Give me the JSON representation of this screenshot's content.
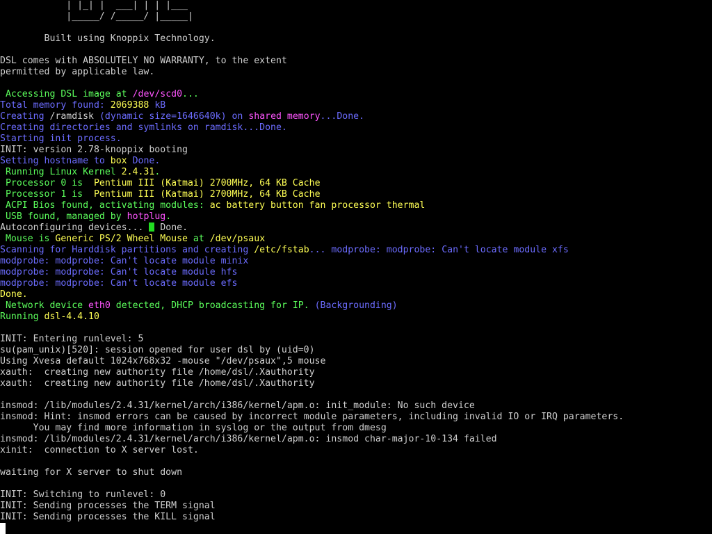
{
  "terminal": {
    "banner": {
      "ascii_line_1": "            | |_| |  ___| | | |___",
      "ascii_line_2": "            |_____/ /_____/ |_____|",
      "built_with": "        Built using Knoppix Technology.",
      "warranty_1": "DSL comes with ABSOLUTELY NO WARRANTY, to the extent",
      "warranty_2": "permitted by applicable law."
    },
    "boot": {
      "access_prefix": " Accessing DSL image at ",
      "access_dev": "/dev/scd0",
      "access_suffix": "...",
      "mem_label": "Total memory found: ",
      "mem_value": "2069388",
      "mem_unit": " kB",
      "ramdisk_prefix": "Creating ",
      "ramdisk_name": "/ramdisk",
      "ramdisk_mid": " (dynamic size=1646640k) on ",
      "ramdisk_shared": "shared memory",
      "ramdisk_done": "...Done.",
      "dirs": "Creating directories and symlinks on ramdisk...Done.",
      "init_proc": "Starting init process.",
      "init_version": "INIT: version 2.78-knoppix booting",
      "hostname_prefix": "Setting hostname to ",
      "hostname_value": "box",
      "hostname_done": " Done.",
      "kernel_label": " Running Linux Kernel ",
      "kernel_version": "2.4.31",
      "kernel_dot": ".",
      "cpu0_label": " Processor 0 is  ",
      "cpu0_value": "Pentium III (Katmai) 2700MHz, 64 KB Cache",
      "cpu1_label": " Processor 1 is  ",
      "cpu1_value": "Pentium III (Katmai) 2700MHz, 64 KB Cache",
      "acpi_label": " ACPI Bios found, activating modules: ",
      "acpi_modules": "ac battery button fan processor thermal",
      "usb_label": " USB found, managed by ",
      "usb_value": "hotplug",
      "usb_dot": ".",
      "autoconf_label": "Autoconfiguring devices... ",
      "autoconf_done": " Done.",
      "mouse_label": " Mouse is ",
      "mouse_value": "Generic PS/2 Wheel Mouse",
      "mouse_at": " at ",
      "mouse_dev": "/dev/psaux",
      "scan_prefix": "Scanning for Harddisk partitions and creating ",
      "scan_file": "/etc/fstab",
      "scan_suffix": "... modprobe: modprobe: Can't locate module xfs",
      "modprobe_minix": "modprobe: modprobe: Can't locate module minix",
      "modprobe_hfs": "modprobe: modprobe: Can't locate module hfs",
      "modprobe_efs": "modprobe: modprobe: Can't locate module efs",
      "done": "Done.",
      "net_label": " Network device ",
      "net_iface": "eth0",
      "net_mid": " detected, DHCP broadcasting for IP. ",
      "net_bg": "(Backgrounding)",
      "running_label": "Running ",
      "running_value": "dsl-4.4.10"
    },
    "runlevel": {
      "enter": "INIT: Entering runlevel: 5",
      "su": "su(pam_unix)[520]: session opened for user dsl by (uid=0)",
      "xvesa": "Using Xvesa default 1024x768x32 -mouse \"/dev/psaux\",5 mouse",
      "xauth_1": "xauth:  creating new authority file /home/dsl/.Xauthority",
      "xauth_2": "xauth:  creating new authority file /home/dsl/.Xauthority"
    },
    "errors": {
      "insmod_1": "insmod: /lib/modules/2.4.31/kernel/arch/i386/kernel/apm.o: init_module: No such device",
      "insmod_hint": "insmod: Hint: insmod errors can be caused by incorrect module parameters, including invalid IO or IRQ parameters.",
      "insmod_hint_2": "      You may find more information in syslog or the output from dmesg",
      "insmod_2": "insmod: /lib/modules/2.4.31/kernel/arch/i386/kernel/apm.o: insmod char-major-10-134 failed",
      "xinit": "xinit:  connection to X server lost.",
      "waiting": "waiting for X server to shut down"
    },
    "shutdown": {
      "switch": "INIT: Switching to runlevel: 0",
      "term": "INIT: Sending processes the TERM signal",
      "kill": "INIT: Sending processes the KILL signal"
    },
    "colors": {
      "default": "#d0d0d0",
      "blue": "#6c6cff",
      "green": "#5cff5c",
      "yellow": "#ffff55",
      "magenta": "#ff55ff"
    }
  }
}
